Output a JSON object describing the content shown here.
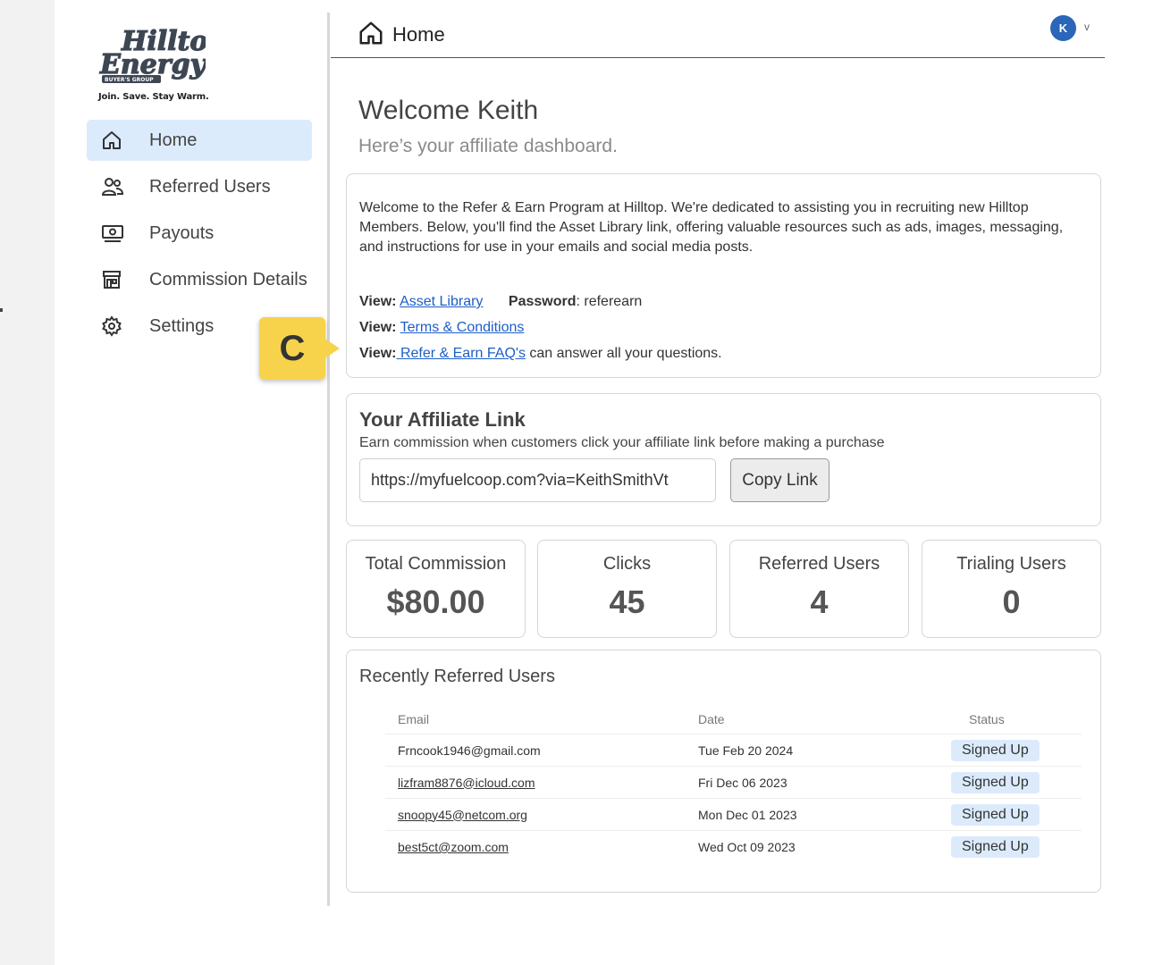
{
  "brand": {
    "logo_line1": "Hilltop",
    "logo_line2": "Energy",
    "logo_badge": "BUYER'S GROUP",
    "tagline": "Join. Save. Stay Warm."
  },
  "sidebar": {
    "items": [
      {
        "label": "Home",
        "icon": "home-icon",
        "active": true
      },
      {
        "label": "Referred Users",
        "icon": "users-icon",
        "active": false
      },
      {
        "label": "Payouts",
        "icon": "payout-icon",
        "active": false
      },
      {
        "label": "Commission Details",
        "icon": "store-icon",
        "active": false
      },
      {
        "label": "Settings",
        "icon": "gear-icon",
        "active": false
      }
    ]
  },
  "callout": {
    "letter": "C",
    "color": "#f7d34c"
  },
  "header": {
    "title": "Home",
    "avatar_initial": "K",
    "avatar_chevron": "v"
  },
  "welcome": {
    "title": "Welcome Keith",
    "subtitle": "Here’s your affiliate dashboard."
  },
  "info": {
    "paragraph": "Welcome to the Refer & Earn Program at Hilltop. We're dedicated to assisting you in recruiting new Hilltop Members. Below, you'll find the Asset Library link, offering valuable resources such as ads, images, messaging, and instructions for use in your emails and social media posts.",
    "view_label": "View:",
    "asset_library_link": "Asset Library",
    "password_label": "Password",
    "password_value": ": referearn",
    "terms_link": "Terms & Conditions",
    "faq_link": " Refer & Earn FAQ's",
    "faq_suffix": " can answer all your questions."
  },
  "affiliate": {
    "title": "Your Affiliate Link",
    "description": "Earn commission when customers click your affiliate link before making a purchase",
    "link_value": "https://myfuelcoop.com?via=KeithSmithVt",
    "copy_button": "Copy Link"
  },
  "stats": [
    {
      "label": "Total Commission",
      "value": "$80.00"
    },
    {
      "label": "Clicks",
      "value": "45"
    },
    {
      "label": "Referred Users",
      "value": "4"
    },
    {
      "label": "Trialing Users",
      "value": "0"
    }
  ],
  "recent": {
    "title": "Recently Referred Users",
    "columns": [
      "Email",
      "Date",
      "Status"
    ],
    "rows": [
      {
        "email": "Frncook1946@gmail.com",
        "date": "Tue Feb 20 2024",
        "status": "Signed Up"
      },
      {
        "email": "lizfram8876@icloud.com",
        "date": "Fri Dec 06 2023",
        "status": "Signed Up"
      },
      {
        "email": "snoopy45@netcom.org",
        "date": "Mon Dec 01 2023",
        "status": "Signed Up"
      },
      {
        "email": "best5ct@zoom.com",
        "date": "Wed Oct 09 2023",
        "status": "Signed Up"
      }
    ]
  },
  "colors": {
    "active_nav": "#dcebfb",
    "link": "#1d5ec9",
    "avatar": "#2b66b8",
    "badge": "#dcebfb"
  }
}
